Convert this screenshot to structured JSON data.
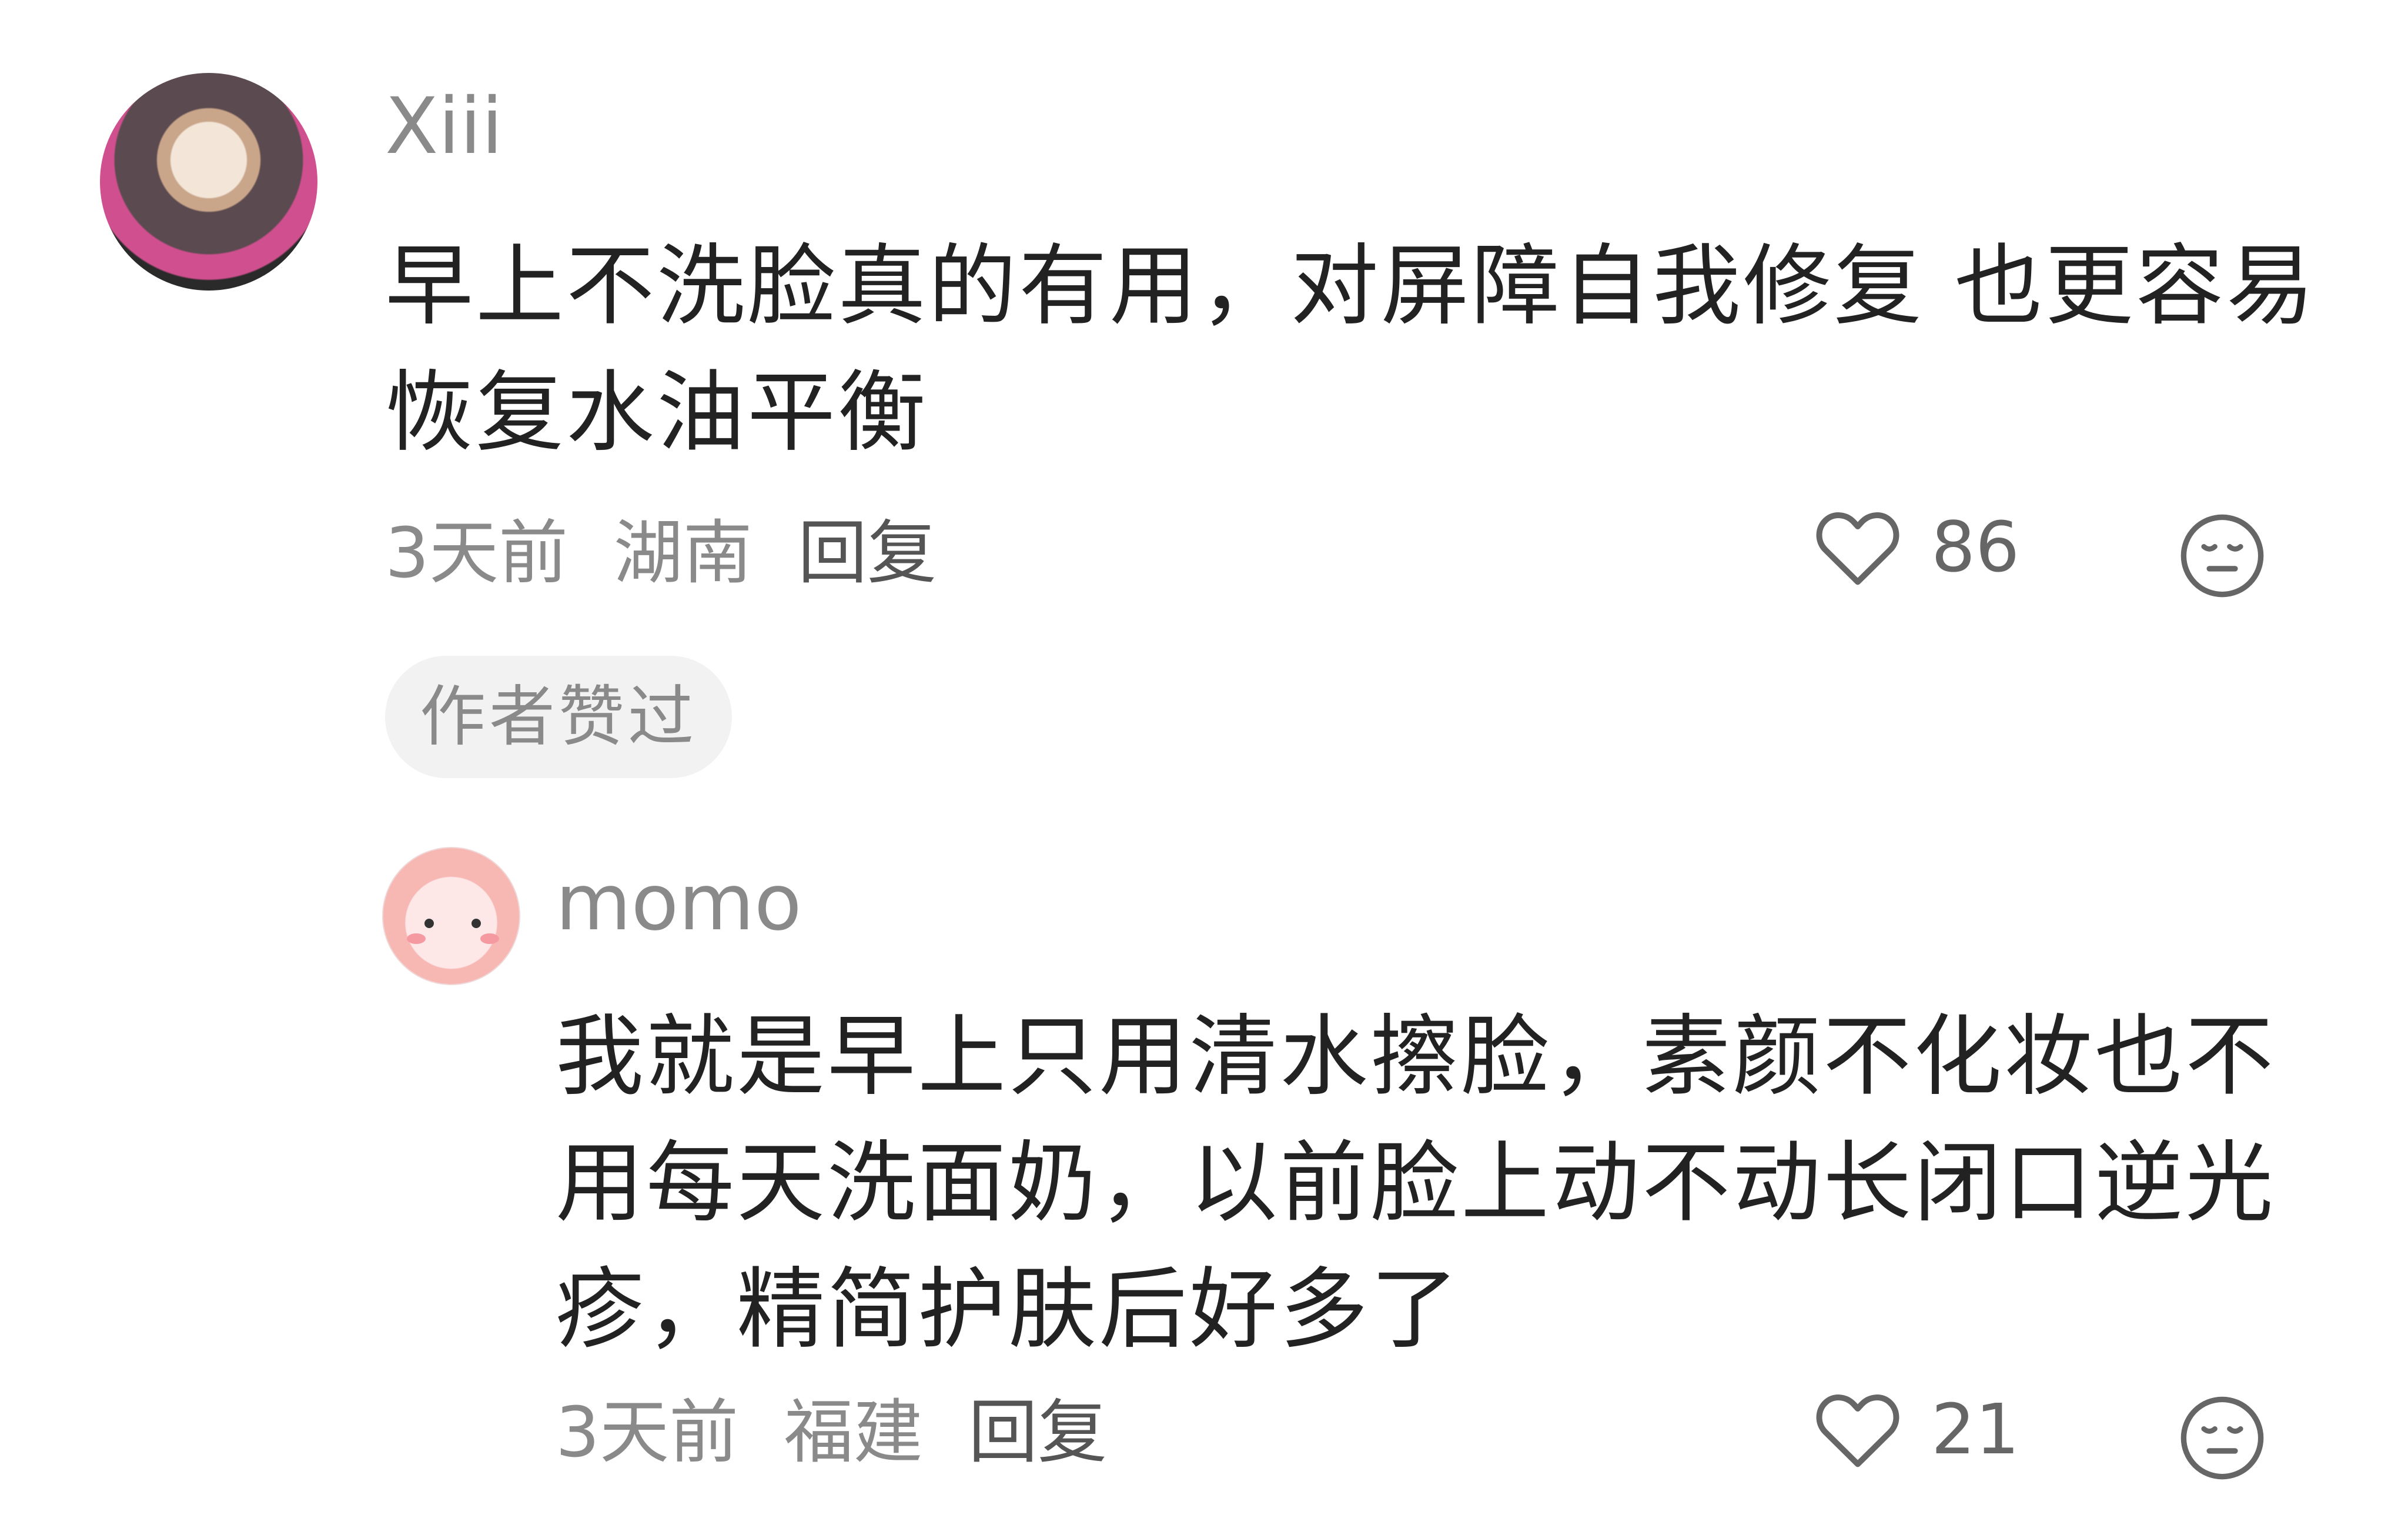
{
  "comments": [
    {
      "username": "Xiii",
      "text": "早上不洗脸真的有用，对屏障自我修复 也更容易恢复水油平衡",
      "time": "3天前",
      "location": "湖南",
      "reply_label": "回复",
      "likes": "86",
      "badge": "作者赞过",
      "avatar_icon": "user-photo-avatar",
      "like_icon": "heart-icon",
      "dislike_icon": "meh-face-icon"
    },
    {
      "username": "momo",
      "text": "我就是早上只用清水擦脸，素颜不化妆也不用每天洗面奶，以前脸上动不动长闭口逆光疹，精简护肤后好多了",
      "time": "3天前",
      "location": "福建",
      "reply_label": "回复",
      "likes": "21",
      "avatar_icon": "cartoon-avatar",
      "like_icon": "heart-icon",
      "dislike_icon": "meh-face-icon"
    }
  ],
  "colors": {
    "username": "#8a8a8a",
    "body": "#222222",
    "meta": "#8a8a8a",
    "badge_bg": "#f2f2f2"
  }
}
